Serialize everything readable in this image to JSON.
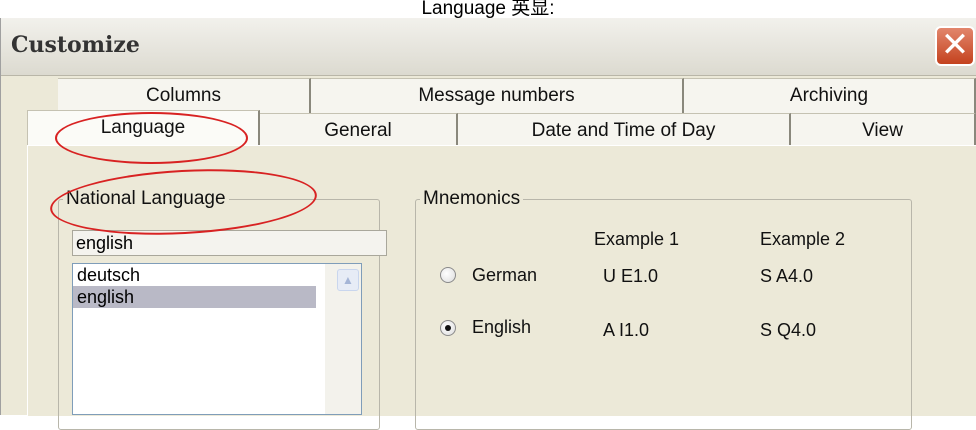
{
  "caption": "Language 英显:",
  "window": {
    "title": "Customize",
    "close_icon": "close-icon",
    "close_glyph": "✕"
  },
  "tabs": {
    "back_row": [
      "Columns",
      "Message numbers",
      "Archiving"
    ],
    "front_row": [
      "Language",
      "General",
      "Date and Time of Day",
      "View"
    ],
    "selected": "Language"
  },
  "national_language": {
    "group_label": "National Language",
    "current_value": "english",
    "options": [
      "deutsch",
      "english"
    ],
    "selected_option": "english",
    "scroll_up_glyph": "▲"
  },
  "mnemonics": {
    "group_label": "Mnemonics",
    "col_headers": [
      "Example 1",
      "Example 2"
    ],
    "rows": [
      {
        "label": "German",
        "example1": "U E1.0",
        "example2": "S A4.0",
        "checked": false
      },
      {
        "label": "English",
        "example1": "A I1.0",
        "example2": "S Q4.0",
        "checked": true
      }
    ]
  },
  "colors": {
    "dialog_bg": "#ece9d8",
    "highlight_ellipse": "#d82222",
    "selected_item_bg": "#b9b9c6",
    "close_button": "#c4421e"
  }
}
